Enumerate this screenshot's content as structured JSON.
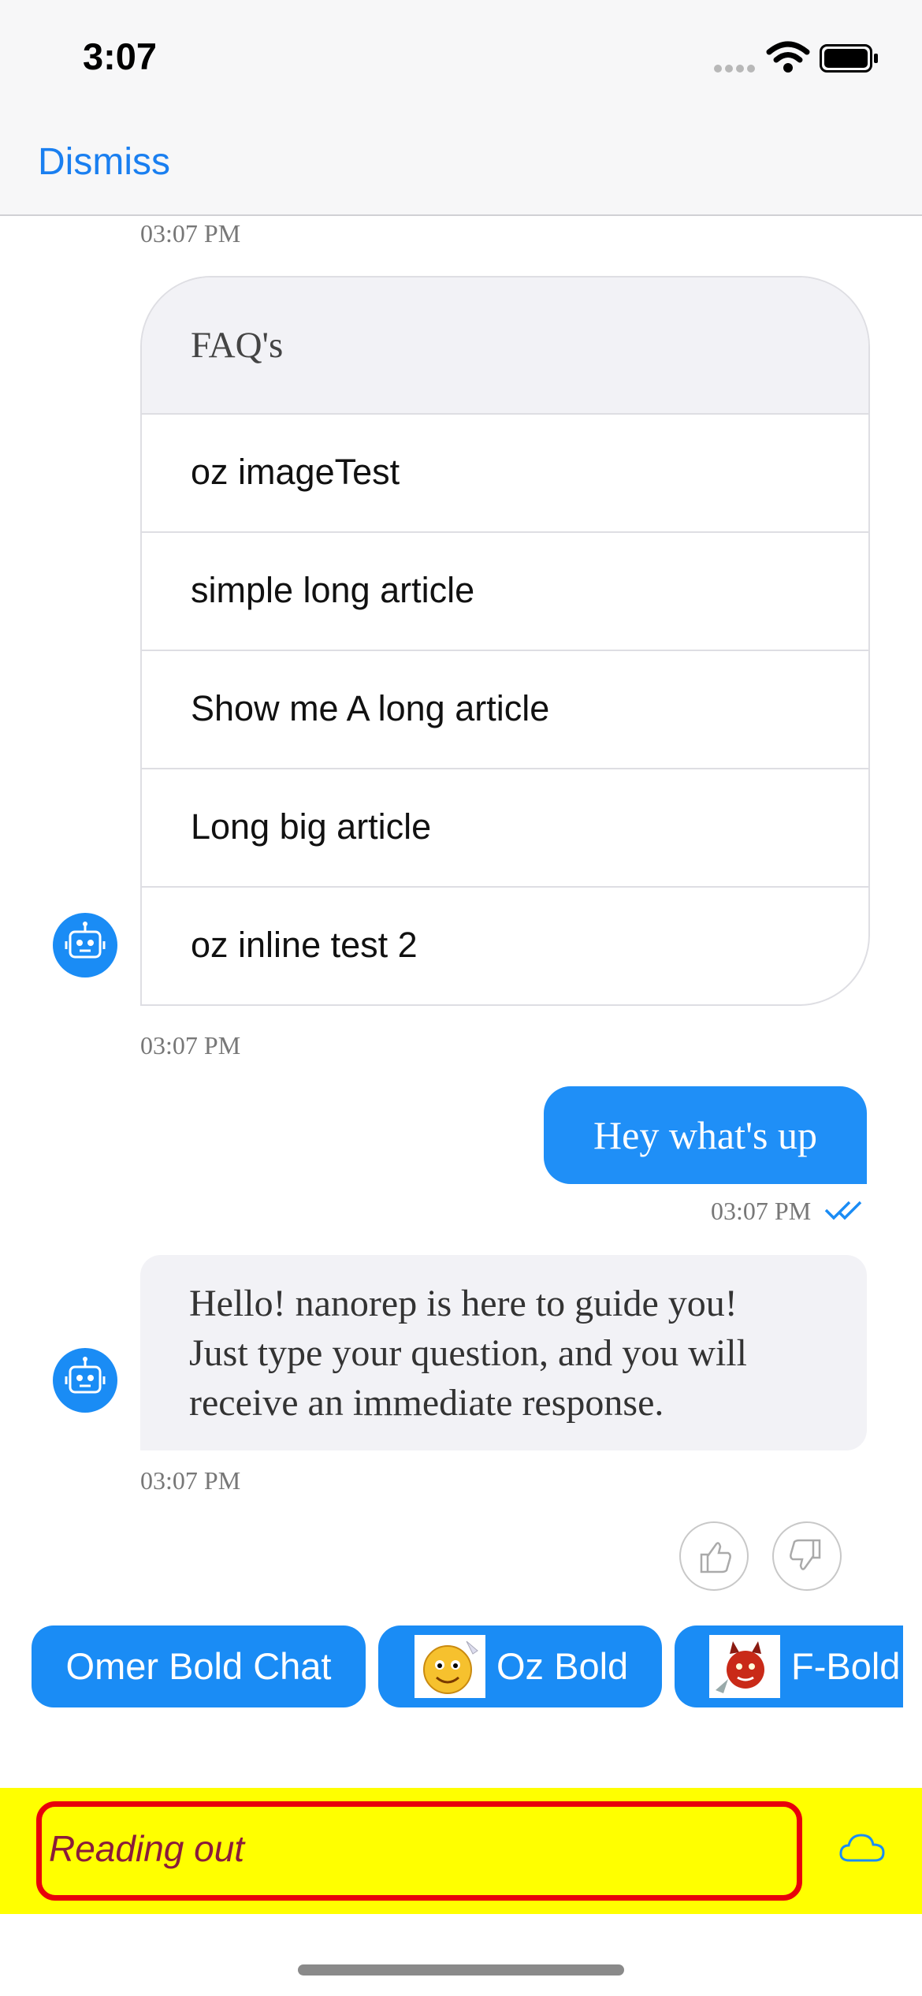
{
  "status_bar": {
    "time": "3:07"
  },
  "nav": {
    "dismiss": "Dismiss"
  },
  "faq": {
    "timestamp": "03:07 PM",
    "title": "FAQ's",
    "items": [
      "oz imageTest",
      "simple long article",
      "Show me A long article",
      "Long big article",
      "oz inline test 2"
    ]
  },
  "messages": {
    "faq_footer_time": "03:07 PM",
    "user": {
      "text": "Hey what's up",
      "time": "03:07 PM"
    },
    "bot": {
      "line1": "Hello! nanorep is here to guide you!",
      "line2": "Just type your question, and you will",
      "line3": "receive an immediate response.",
      "time": "03:07 PM"
    }
  },
  "quick_replies": [
    "Omer Bold Chat",
    "Oz Bold",
    "F-Bold"
  ],
  "input": {
    "value": "Reading out"
  },
  "colors": {
    "accent": "#1a8cf5",
    "input_bg": "#ffff00",
    "input_border": "#e8000a"
  }
}
